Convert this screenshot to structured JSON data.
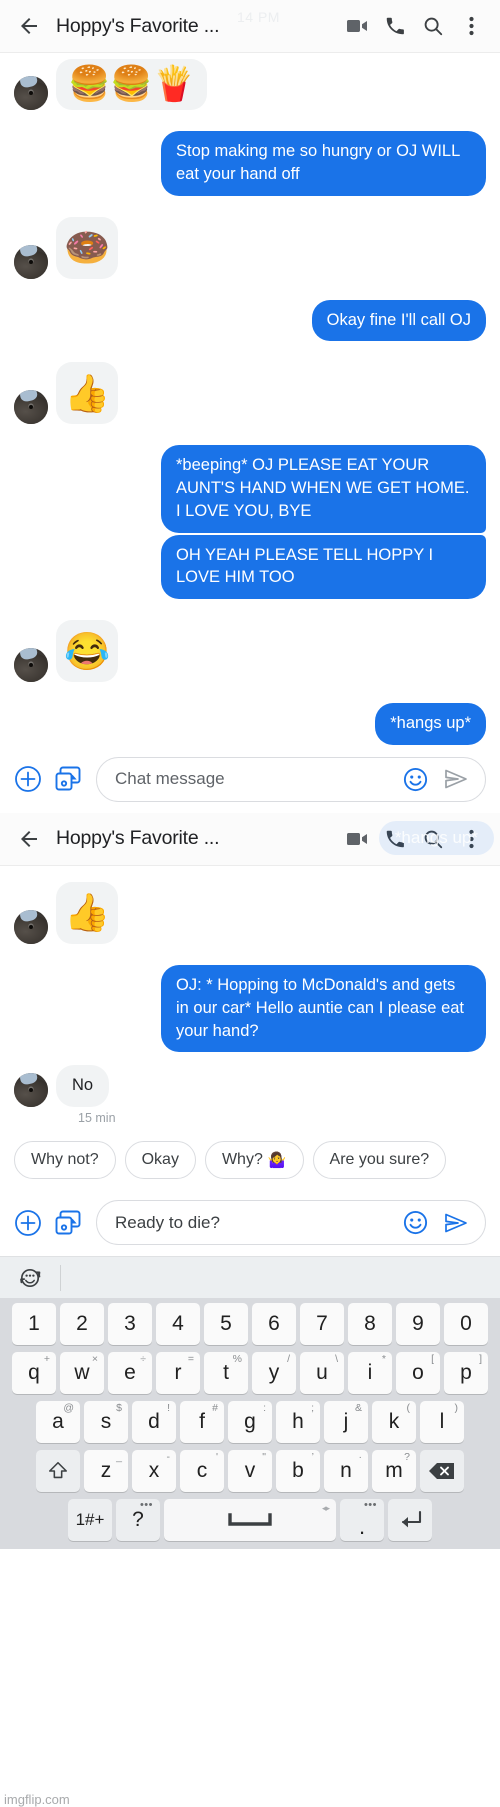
{
  "app": {
    "header_1": {
      "title": "Hoppy's Favorite ...",
      "ghost_time": "14 PM",
      "back_icon": "back-arrow-icon",
      "video_icon": "video-call-icon",
      "call_icon": "phone-call-icon",
      "search_icon": "search-icon",
      "more_icon": "more-vertical-icon"
    },
    "header_2": {
      "title": "Hoppy's Favorite ...",
      "ghost_bubble": "*hangs up*"
    }
  },
  "thread_1": {
    "messages": [
      {
        "side": "in",
        "type": "sticker_wide",
        "text": "🍔🍔🍟"
      },
      {
        "side": "out",
        "type": "text",
        "text": "Stop making me so hungry or OJ WILL eat your hand off"
      },
      {
        "side": "in",
        "type": "sticker",
        "text": "🍩"
      },
      {
        "side": "out",
        "type": "text",
        "text": "Okay fine I'll call OJ"
      },
      {
        "side": "in",
        "type": "sticker",
        "text": "👍"
      },
      {
        "side": "out",
        "type": "text",
        "text": "*beeping* OJ  PLEASE EAT YOUR AUNT'S HAND WHEN WE GET HOME. I LOVE YOU, BYE"
      },
      {
        "side": "out",
        "type": "text",
        "text": "OH YEAH PLEASE TELL HOPPY I LOVE HIM TOO"
      },
      {
        "side": "in",
        "type": "sticker",
        "text": "😂"
      },
      {
        "side": "out",
        "type": "text",
        "text": "*hangs up*"
      }
    ]
  },
  "composer_1": {
    "placeholder": "Chat message",
    "value": "",
    "plus_icon": "add-plus-icon",
    "gallery_icon": "image-camera-icon",
    "emoji_icon": "emoji-smiley-icon",
    "send_icon": "send-icon",
    "send_active": false
  },
  "thread_2": {
    "messages": [
      {
        "side": "in",
        "type": "sticker",
        "text": "👍"
      },
      {
        "side": "out",
        "type": "text",
        "text": "OJ: * Hopping to McDonald's and gets in our car* Hello auntie can I please eat your hand?"
      },
      {
        "side": "in",
        "type": "text",
        "text": "No"
      }
    ],
    "timestamp": "15 min"
  },
  "suggestions": {
    "chips": [
      {
        "label": "Why not?",
        "emoji": ""
      },
      {
        "label": "Okay",
        "emoji": ""
      },
      {
        "label": "Why?",
        "emoji": "🤷‍♀️"
      },
      {
        "label": "Are you sure?",
        "emoji": ""
      }
    ]
  },
  "composer_2": {
    "placeholder": "Chat message",
    "value": "Ready to die?",
    "plus_icon": "add-plus-icon",
    "gallery_icon": "image-camera-icon",
    "emoji_icon": "emoji-smiley-icon",
    "send_icon": "send-icon",
    "send_active": true
  },
  "keyboard": {
    "gif_icon": "emoji-rotate-icon",
    "row_numbers": [
      {
        "key": "1"
      },
      {
        "key": "2"
      },
      {
        "key": "3"
      },
      {
        "key": "4"
      },
      {
        "key": "5"
      },
      {
        "key": "6"
      },
      {
        "key": "7"
      },
      {
        "key": "8"
      },
      {
        "key": "9"
      },
      {
        "key": "0"
      }
    ],
    "row_q": [
      {
        "key": "q",
        "sup": "+"
      },
      {
        "key": "w",
        "sup": "×"
      },
      {
        "key": "e",
        "sup": "÷"
      },
      {
        "key": "r",
        "sup": "="
      },
      {
        "key": "t",
        "sup": "%"
      },
      {
        "key": "y",
        "sup": "/"
      },
      {
        "key": "u",
        "sup": "\\"
      },
      {
        "key": "i",
        "sup": "*"
      },
      {
        "key": "o",
        "sup": "["
      },
      {
        "key": "p",
        "sup": "]"
      }
    ],
    "row_a": [
      {
        "key": "a",
        "sup": "@"
      },
      {
        "key": "s",
        "sup": "$"
      },
      {
        "key": "d",
        "sup": "!"
      },
      {
        "key": "f",
        "sup": "#"
      },
      {
        "key": "g",
        "sup": ":"
      },
      {
        "key": "h",
        "sup": ";"
      },
      {
        "key": "j",
        "sup": "&"
      },
      {
        "key": "k",
        "sup": "("
      },
      {
        "key": "l",
        "sup": ")"
      }
    ],
    "row_z": [
      {
        "key": "z",
        "sup": "_"
      },
      {
        "key": "x",
        "sup": "-"
      },
      {
        "key": "c",
        "sup": "'"
      },
      {
        "key": "v",
        "sup": "\""
      },
      {
        "key": "b",
        "sup": "’"
      },
      {
        "key": "n",
        "sup": "·"
      },
      {
        "key": "m",
        "sup": "?"
      }
    ],
    "shift_label": "shift-key-icon",
    "backspace_label": "backspace-key-icon",
    "symbols_label": "1#+",
    "question_label": "?",
    "period_label": ".",
    "enter_label": "enter-key-icon",
    "space_label": "space-key-icon"
  },
  "watermark": "imgflip.com",
  "colors": {
    "outgoing_bubble": "#1a73e8",
    "incoming_bubble": "#f1f3f4",
    "accent": "#1a73e8",
    "keyboard_bg": "#d8dade",
    "key_bg": "#fafafa"
  }
}
